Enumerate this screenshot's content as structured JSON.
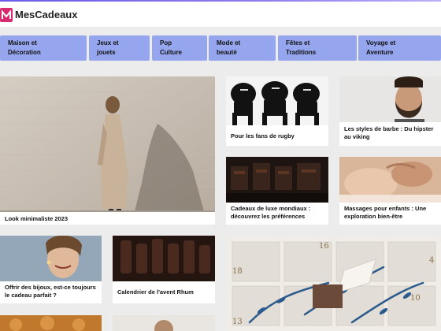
{
  "brand": {
    "name": "MesCadeaux"
  },
  "nav": [
    {
      "line1": "Maison et",
      "line2": "Décoration"
    },
    {
      "line1": "Jeux et",
      "line2": "jouets"
    },
    {
      "line1": "Pop",
      "line2": "Culture"
    },
    {
      "line1": "Mode et",
      "line2": "beauté"
    },
    {
      "line1": "Fêtes et",
      "line2": "Traditions"
    },
    {
      "line1": "Voyage et",
      "line2": "Aventure"
    }
  ],
  "articles": {
    "minimalist": "Look minimaliste 2023",
    "rugby": "Pour les fans de rugby",
    "beard": "Les styles de barbe : Du hipster au viking",
    "luxury": "Cadeaux de luxe mondiaux : découvrez les préférences",
    "massage": "Massages pour enfants : Une exploration bien-être",
    "jewelry": "Offrir des bijoux, est-ce toujours le cadeau parfait ?",
    "advent": "Calendrier de l'avent Rhum"
  },
  "advent_numbers": [
    "16",
    "18",
    "4",
    "10",
    "13"
  ]
}
